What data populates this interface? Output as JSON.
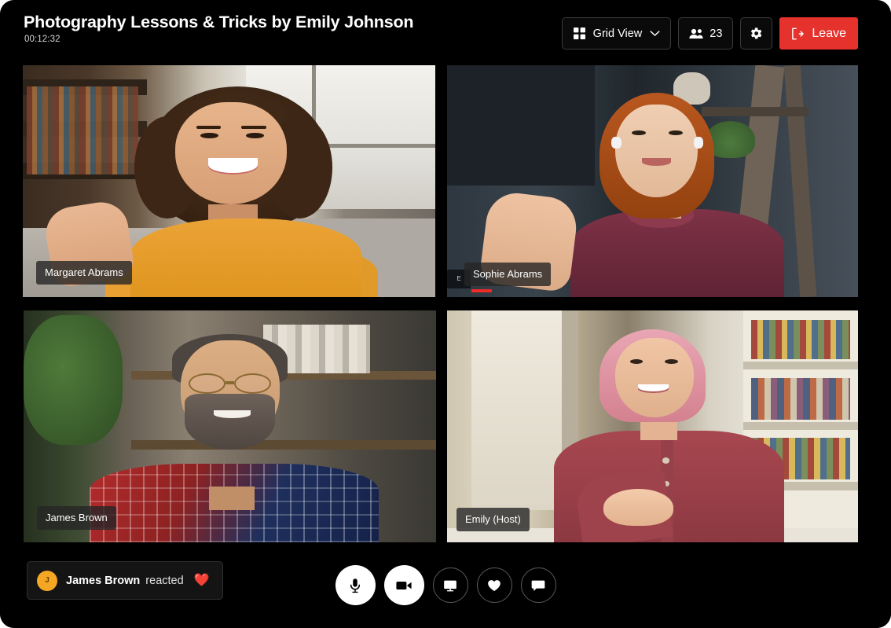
{
  "header": {
    "title": "Photography Lessons & Tricks by Emily Johnson",
    "timer": "00:12:32",
    "view_mode": {
      "label": "Grid View",
      "icon": "grid-icon",
      "chevron": "chevron-down-icon"
    },
    "participants": {
      "icon": "people-icon",
      "count": "23"
    },
    "settings": {
      "icon": "gear-icon"
    },
    "leave": {
      "label": "Leave",
      "icon": "exit-icon",
      "color": "#e5322d"
    }
  },
  "grid": {
    "tiles": [
      {
        "name": "Margaret Abrams"
      },
      {
        "name": "Sophie Abrams",
        "badge_text": "E",
        "speaking_bar_color": "#ee2b24"
      },
      {
        "name": "James Brown"
      },
      {
        "name": "Emily (Host)"
      }
    ]
  },
  "footer": {
    "reaction": {
      "avatar_initial": "J",
      "avatar_color": "#f5a623",
      "name": "James Brown",
      "verb": "reacted",
      "emoji": "❤️"
    },
    "controls": [
      {
        "name": "microphone",
        "icon": "microphone-icon",
        "state": "on"
      },
      {
        "name": "camera",
        "icon": "camera-icon",
        "state": "on"
      },
      {
        "name": "share-screen",
        "icon": "screen-share-icon",
        "state": "off"
      },
      {
        "name": "reactions",
        "icon": "heart-icon",
        "state": "off"
      },
      {
        "name": "chat",
        "icon": "chat-icon",
        "state": "off"
      }
    ]
  }
}
